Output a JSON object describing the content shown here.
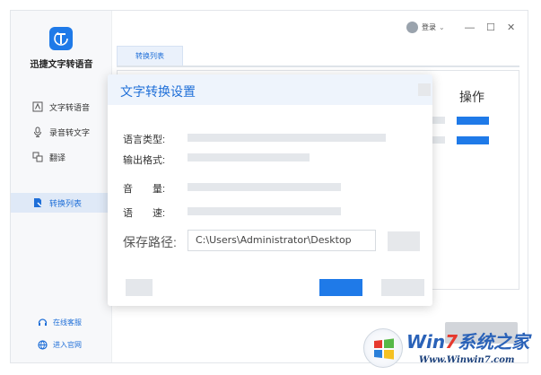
{
  "app": {
    "name": "迅捷文字转语音"
  },
  "sidebar": {
    "items": [
      {
        "label": "文字转语音",
        "icon": "text-document-icon",
        "active": false
      },
      {
        "label": "录音转文字",
        "icon": "microphone-icon",
        "active": false
      },
      {
        "label": "翻译",
        "icon": "translate-icon",
        "active": false
      },
      {
        "label": "转换列表",
        "icon": "list-file-icon",
        "active": true
      }
    ],
    "footer": [
      {
        "label": "在线客服",
        "icon": "headset-icon"
      },
      {
        "label": "进入官网",
        "icon": "globe-icon"
      }
    ]
  },
  "topbar": {
    "login_label": "登录",
    "minimize": "—",
    "maximize": "☐",
    "close": "✕"
  },
  "main": {
    "tab": "转换列表",
    "operation_header": "操作"
  },
  "dialog": {
    "title": "文字转换设置",
    "fields": [
      {
        "label": "语言类型:"
      },
      {
        "label": "输出格式:"
      },
      {
        "label": "音　　量:"
      },
      {
        "label": "语　　速:"
      }
    ],
    "save_path_label": "保存路径:",
    "save_path_value": "C:\\Users\\Administrator\\Desktop"
  },
  "watermark": {
    "title_a": "Win",
    "title_b": "7",
    "title_c": "系统之家",
    "url": "Www.Winwin7.com"
  },
  "colors": {
    "accent": "#1f7ae8",
    "active_bg": "#dfe9f7",
    "placeholder_bar": "#e4e7eb",
    "dialog_header": "#eef4fc"
  }
}
